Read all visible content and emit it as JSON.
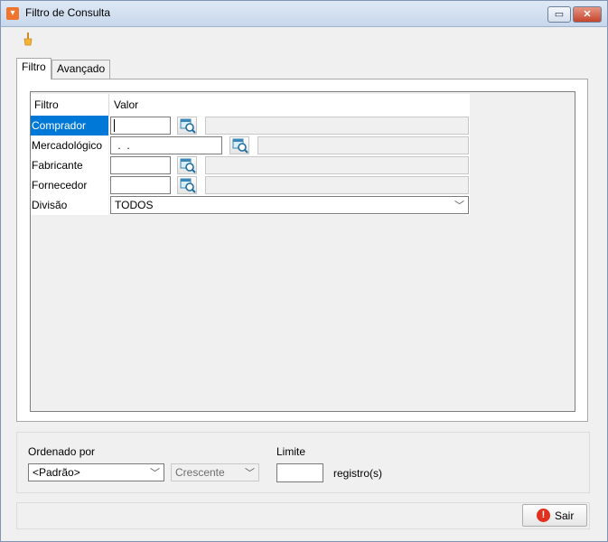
{
  "window": {
    "title": "Filtro de Consulta",
    "restore_glyph": "▭",
    "close_glyph": "✕"
  },
  "toolbar": {
    "clear_icon": "broom-icon"
  },
  "tabs": [
    {
      "label": "Filtro"
    },
    {
      "label": "Avançado"
    }
  ],
  "grid": {
    "headers": {
      "filtro": "Filtro",
      "valor": "Valor"
    },
    "rows": [
      {
        "label": "Comprador",
        "value": ""
      },
      {
        "label": "Mercadológico",
        "value": " .  ."
      },
      {
        "label": "Fabricante",
        "value": ""
      },
      {
        "label": "Fornecedor",
        "value": ""
      },
      {
        "label": "Divisão",
        "value": "TODOS"
      }
    ]
  },
  "order": {
    "label": "Ordenado por",
    "value": "<Padrão>",
    "direction": "Crescente"
  },
  "limit": {
    "label": "Limite",
    "value": "",
    "unit": "registro(s)"
  },
  "footer": {
    "exit_label": "Sair"
  },
  "colors": {
    "selection": "#0078d7",
    "exit_icon": "#e0301e",
    "accent": "#f0742c"
  }
}
